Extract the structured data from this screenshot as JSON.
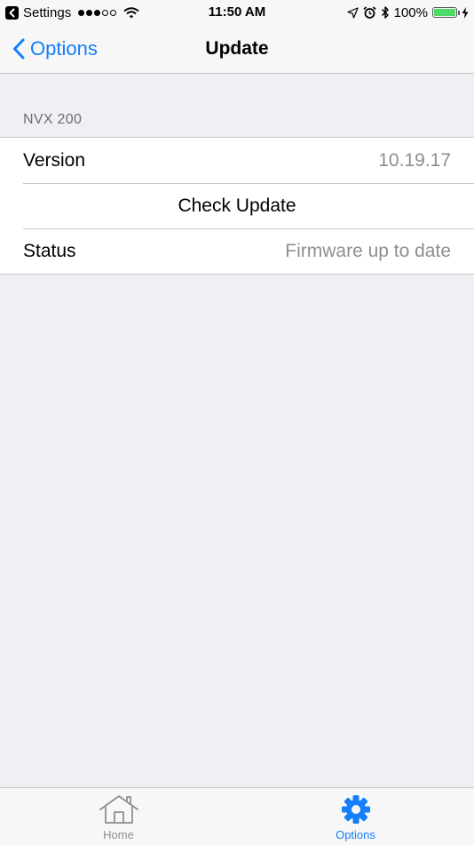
{
  "status_bar": {
    "back_app": "Settings",
    "signal_dots": [
      true,
      true,
      true,
      false,
      false
    ],
    "time": "11:50 AM",
    "battery_percent": "100%",
    "battery_level": 1.0
  },
  "nav": {
    "back_label": "Options",
    "title": "Update"
  },
  "section": {
    "header": "NVX 200",
    "rows": {
      "version_label": "Version",
      "version_value": "10.19.17",
      "check_update_label": "Check Update",
      "status_label": "Status",
      "status_value": "Firmware up to date"
    }
  },
  "tab_bar": {
    "tabs": [
      {
        "label": "Home",
        "icon": "house-icon",
        "selected": false
      },
      {
        "label": "Options",
        "icon": "gear-icon",
        "selected": true
      }
    ]
  },
  "colors": {
    "accent": "#147efb",
    "background": "#efeff4",
    "secondary_text": "#8e8e93",
    "battery": "#4cd964"
  }
}
